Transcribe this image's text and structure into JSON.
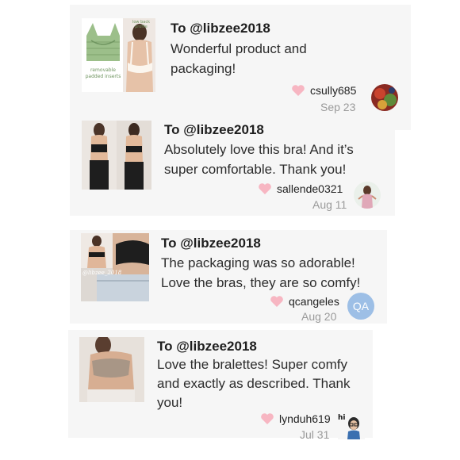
{
  "reviews": [
    {
      "to": "To @libzee2018",
      "message_lines": [
        "Wonderful product and",
        "packaging!"
      ],
      "username": "csully685",
      "date": "Sep 23",
      "thumb_text": {
        "top": "low back profile",
        "bottom": "removable padded inserts"
      }
    },
    {
      "to": "To @libzee2018",
      "message_lines": [
        "Absolutely love this bra! And it’s",
        "super comfortable. Thank you!"
      ],
      "username": "sallende0321",
      "date": "Aug 11"
    },
    {
      "to": "To @libzee2018",
      "message_lines": [
        "The packaging was so adorable!",
        "Love the bras, they are so comfy!"
      ],
      "username": "qcangeles",
      "date": "Aug 20",
      "avatar_initials": "QA",
      "thumb_watermark": "@libzee_2018"
    },
    {
      "to": "To @libzee2018",
      "message_lines": [
        "Love the bralettes! Super comfy",
        "and exactly as described. Thank",
        "you!"
      ],
      "username": "lynduh619",
      "date": "Jul 31",
      "avatar_text": "hi"
    }
  ],
  "colors": {
    "card_bg": "#f6f6f6",
    "heart": "#f7b6c2",
    "date": "#9a9a9a",
    "avatar_qa": "#9dbfe6"
  },
  "icons": {
    "like": "heart-icon"
  }
}
